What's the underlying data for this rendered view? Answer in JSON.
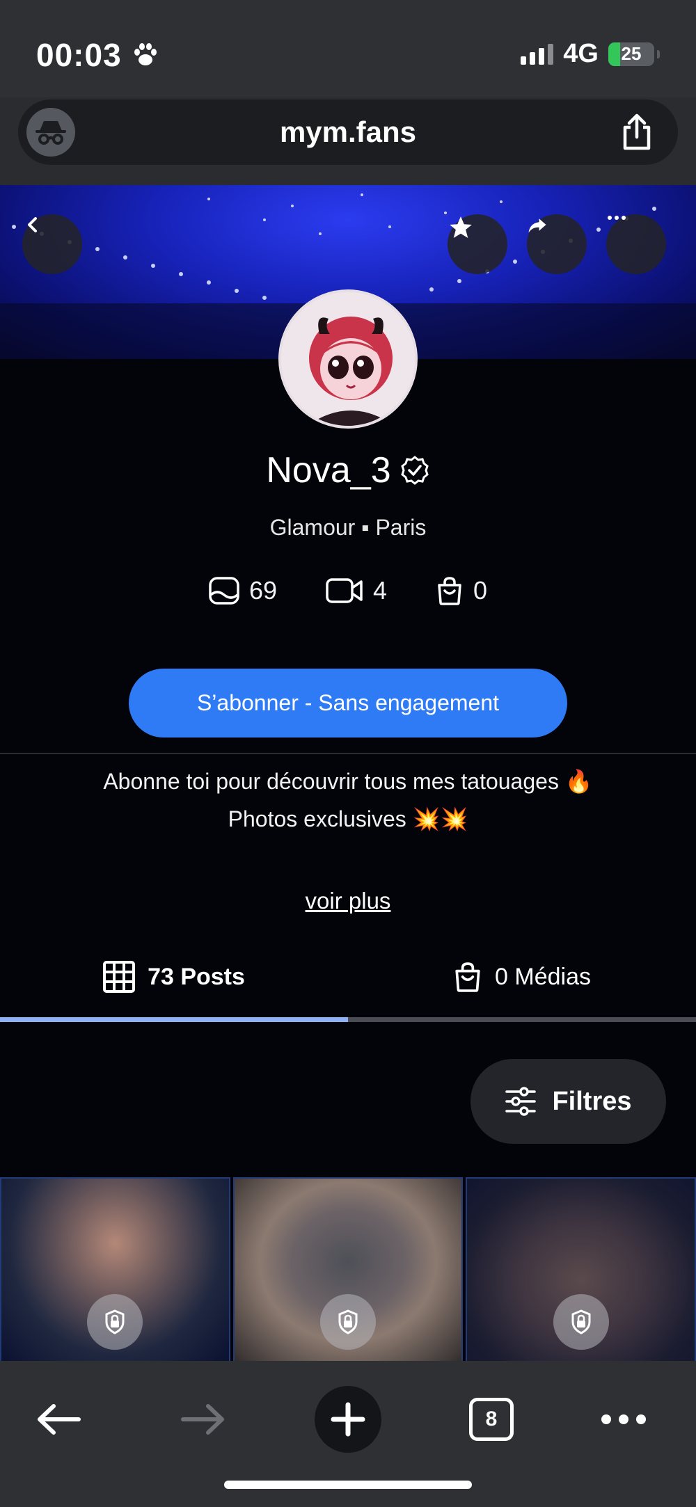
{
  "status": {
    "time": "00:03",
    "network": "4G",
    "battery": "25",
    "battery_level": 0.25,
    "colors": {
      "battery": "#33c759"
    }
  },
  "browser": {
    "url": "mym.fans",
    "icons": [
      "incognito-icon",
      "share-icon"
    ]
  },
  "profile": {
    "name": "Nova_3",
    "verified": true,
    "tagline": "Glamour ▪ Paris",
    "stats": [
      {
        "icon": "photo-icon",
        "value": "69"
      },
      {
        "icon": "video-icon",
        "value": "4"
      },
      {
        "icon": "shopping-bag-icon",
        "value": "0"
      }
    ],
    "subscribe_label": "S’abonner - Sans engagement",
    "bio_line1": "Abonne toi pour découvrir tous mes tatouages 🔥",
    "bio_line2": "Photos exclusives 💥💥",
    "see_more": "voir plus"
  },
  "tabs": [
    {
      "label": "73 Posts",
      "icon": "grid-icon",
      "active": true
    },
    {
      "label": "0 Médias",
      "icon": "shopping-bag-icon",
      "active": false
    }
  ],
  "filters_label": "Filtres",
  "toolbar": {
    "tabs_count": "8"
  },
  "colors": {
    "accent": "#2f7bf6",
    "tab_indicator": "#8fb0f4",
    "page_bg": "#03040a"
  }
}
